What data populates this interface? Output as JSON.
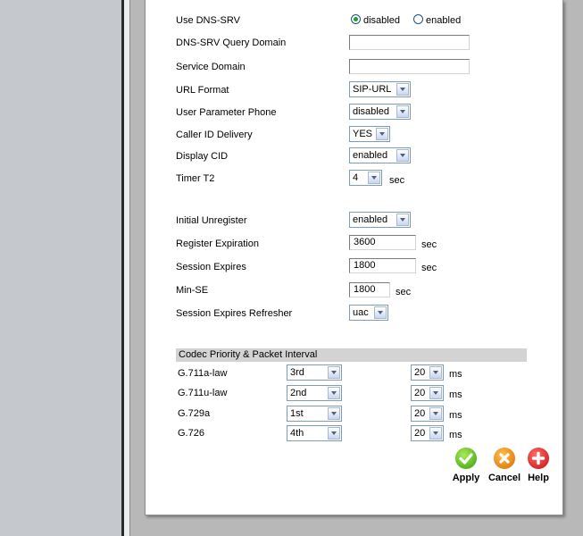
{
  "dns_srv": {
    "label": "Use DNS-SRV",
    "option_disabled": "disabled",
    "option_enabled": "enabled",
    "selected": "disabled"
  },
  "fields": {
    "query_domain": {
      "label": "DNS-SRV Query Domain",
      "value": ""
    },
    "service_domain": {
      "label": "Service Domain",
      "value": ""
    },
    "url_format": {
      "label": "URL Format",
      "value": "SIP-URL"
    },
    "user_param_phone": {
      "label": "User Parameter Phone",
      "value": "disabled"
    },
    "caller_id_delivery": {
      "label": "Caller ID Delivery",
      "value": "YES"
    },
    "display_cid": {
      "label": "Display CID",
      "value": "enabled"
    },
    "timer_t2": {
      "label": "Timer T2",
      "value": "4",
      "unit": "sec"
    },
    "initial_unregister": {
      "label": "Initial Unregister",
      "value": "enabled"
    },
    "register_expiration": {
      "label": "Register Expiration",
      "value": "3600",
      "unit": "sec"
    },
    "session_expires": {
      "label": "Session Expires",
      "value": "1800",
      "unit": "sec"
    },
    "min_se": {
      "label": "Min-SE",
      "value": "1800",
      "unit": "sec"
    },
    "session_refresher": {
      "label": "Session Expires Refresher",
      "value": "uac"
    }
  },
  "codec": {
    "header": "Codec Priority & Packet Interval",
    "rows": [
      {
        "name": "G.711a-law",
        "priority": "3rd",
        "interval": "20",
        "unit": "ms"
      },
      {
        "name": "G.711u-law",
        "priority": "2nd",
        "interval": "20",
        "unit": "ms"
      },
      {
        "name": "G.729a",
        "priority": "1st",
        "interval": "20",
        "unit": "ms"
      },
      {
        "name": "G.726",
        "priority": "4th",
        "interval": "20",
        "unit": "ms"
      }
    ]
  },
  "buttons": {
    "apply": {
      "label": "Apply",
      "icon": "checkmark-icon",
      "color": "#3a9c0e"
    },
    "cancel": {
      "label": "Cancel",
      "icon": "x-icon",
      "color": "#d66a00"
    },
    "help": {
      "label": "Help",
      "icon": "plus-icon",
      "color": "#c40c0c"
    }
  }
}
